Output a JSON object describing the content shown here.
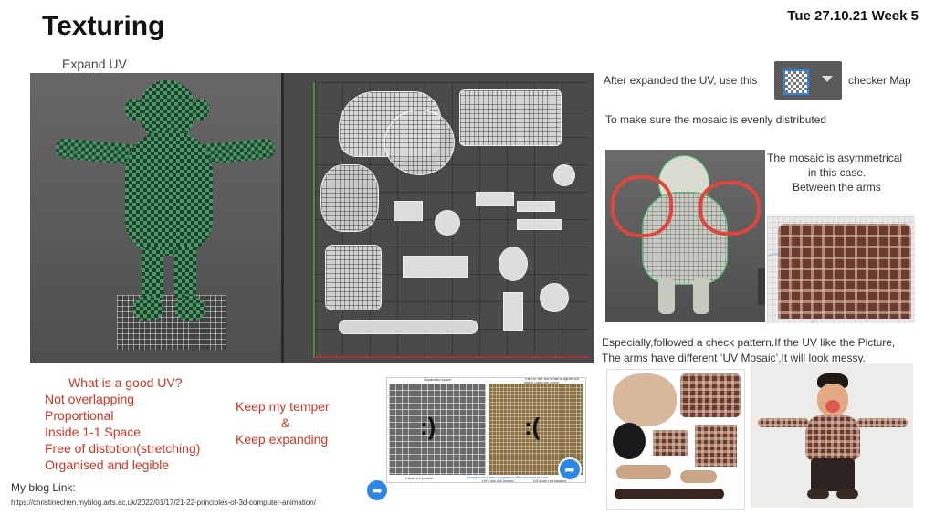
{
  "header": {
    "title": "Texturing",
    "date": "Tue 27.10.21 Week 5"
  },
  "left": {
    "subtitle": "Expand UV",
    "good_uv": {
      "heading": "What is a good UV?",
      "items": [
        "Not overlapping",
        "Proportional",
        "Inside 1-1 Space",
        "Free of distotion(stretching)",
        "Organised and legible"
      ]
    },
    "motto": {
      "line1": "Keep my temper",
      "line2": "&",
      "line3": "Keep  expanding"
    },
    "blog": {
      "label": "My blog Link:",
      "url": "https://christinechen.myblog.arts.ac.uk/2022/01/17/21-22-principles-of-3d-computer-animation/"
    }
  },
  "uv_compare": {
    "note_left": "Separated space",
    "note_right": "The UV are too small to figure out which parts are which",
    "caption_left": "Clean UV pannel",
    "caption_mid": "UV's are too messy",
    "caption_right": "UV's are not packed",
    "source": "Image from https://cgtyphoon.files.wordpress.com"
  },
  "right": {
    "after_text": "After expanded the UV, use this",
    "checker_label": "checker Map",
    "distribution": "To make sure the mosaic is evenly distributed",
    "asym_line1": "The mosaic is asymmetrical",
    "asym_line2": "in this case.",
    "asym_line3": "Between the arms",
    "pattern_line1": "Especially,followed a check pattern.If the UV like the Picture,",
    "pattern_line2": "The arms have different ‘UV Mosaic’.It will look messy."
  },
  "icons": [
    "checker-map-icon",
    "dropdown-arrow-icon",
    "share-arrow-icon"
  ],
  "colors": {
    "accent_red": "#d9331f",
    "viewport_bg": "#5a5a5a",
    "uv_green": "#3d9f64",
    "share_blue": "#2b86e8"
  }
}
